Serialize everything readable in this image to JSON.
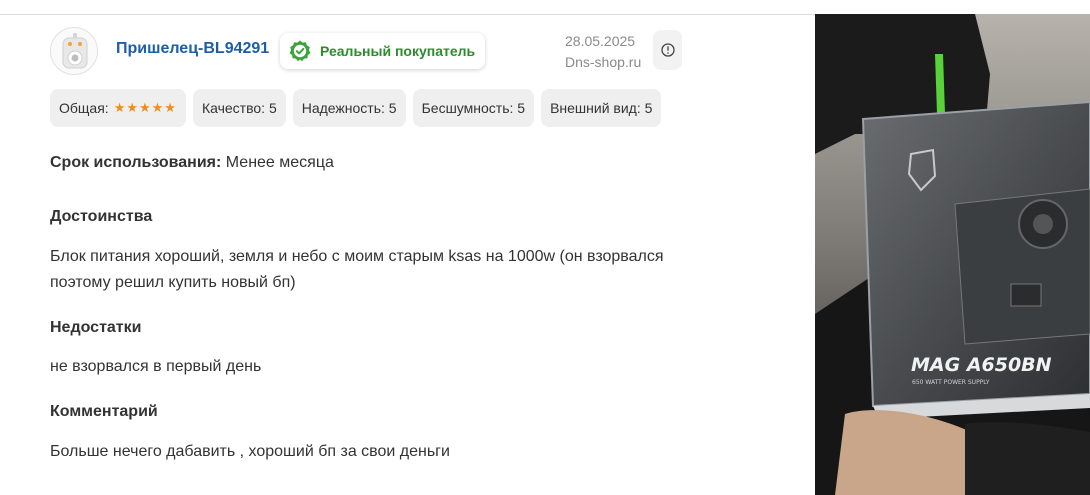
{
  "review": {
    "author": "Пришелец-BL94291",
    "verified_label": "Реальный покупатель",
    "date": "28.05.2025",
    "source": "Dns-shop.ru",
    "ratings": {
      "overall_label": "Общая:",
      "overall_stars": 5,
      "overall_stars_text": "★★★★★",
      "quality": "Качество: 5",
      "reliability": "Надежность: 5",
      "noiseless": "Бесшумность: 5",
      "appearance": "Внешний вид: 5"
    },
    "usage_label": "Срок использования:",
    "usage_value": " Менее месяца",
    "pros_title": "Достоинства",
    "pros_text_line1": "Блок питания хороший, земля и небо с моим старым ksas на 1000w (он взорвался",
    "pros_text_line2": "поэтому решил купить новый бп)",
    "cons_title": "Недостатки",
    "cons_text": "не взорвался в первый день",
    "comment_title": "Комментарий",
    "comment_text": "Больше нечего дабавить , хороший бп за свои деньги"
  },
  "photo": {
    "product_logo_text": "MAG A650BN",
    "product_subtitle": "650 WATT POWER SUPPLY"
  },
  "colors": {
    "author_link": "#1c5ea8",
    "verified_green": "#2e8b2e",
    "star_orange": "#f28c1a",
    "chip_bg": "#efefef"
  }
}
